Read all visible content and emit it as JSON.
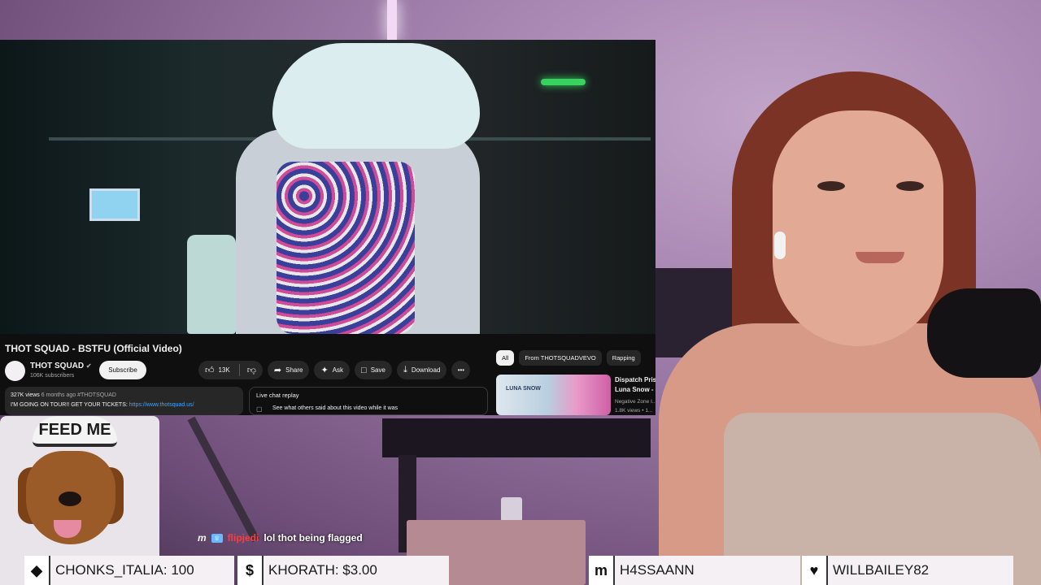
{
  "video": {
    "title": "THOT SQUAD - BSTFU (Official Video)",
    "channel_name": "THOT SQUAD",
    "verified_icon": "verified-check-icon",
    "subscribers": "106K subscribers",
    "subscribe_label": "Subscribe",
    "likes": "13K",
    "share_label": "Share",
    "ask_label": "Ask",
    "save_label": "Save",
    "download_label": "Download",
    "more_label": "•••",
    "description": {
      "views": "327K views",
      "age": "6 months ago",
      "hashtag": "#THOTSQUAD",
      "line2": "I'M GOING ON TOUR!! GET YOUR TICKETS:",
      "link": "https://www.thotsquad.us/"
    },
    "live_chat_replay": {
      "title": "Live chat replay",
      "subtitle": "See what others said about this video while it was"
    }
  },
  "chips": [
    {
      "label": "All",
      "active": true
    },
    {
      "label": "From THOTSQUADVEVO",
      "active": false
    },
    {
      "label": "Rapping",
      "active": false
    }
  ],
  "recommendation": {
    "thumb_text": "LUNA SNOW",
    "title_line1": "Dispatch Pris",
    "title_line2": "Luna Snow - ...",
    "channel": "Negative Zone I...",
    "meta": "1.8K views • 1..."
  },
  "overlay": {
    "feed_me": "FEED ME"
  },
  "chat": {
    "badge": "m",
    "username": "flipjedi",
    "message": "lol thot being flagged"
  },
  "events": [
    {
      "icon": "diamond-icon",
      "glyph": "◆",
      "label": "CHONKS_ITALIA: 100"
    },
    {
      "icon": "dollar-icon",
      "glyph": "$",
      "label": "KHORATH: $3.00"
    },
    {
      "icon": "m-badge-icon",
      "glyph": "m",
      "label": "H4SSAANN"
    },
    {
      "icon": "heart-icon",
      "glyph": "♥",
      "label": "WILLBAILEY82"
    }
  ],
  "colors": {
    "yt_bg": "#0f0f0f",
    "link": "#3ea6ff",
    "chat_username": "#ff3b3b",
    "wall": "#a17fac"
  }
}
